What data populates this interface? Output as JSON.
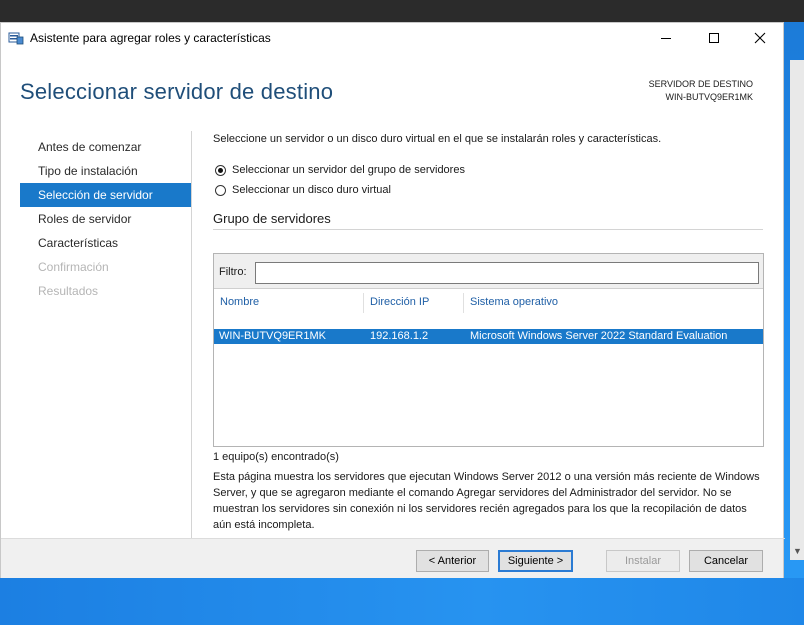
{
  "window": {
    "title": "Asistente para agregar roles y características"
  },
  "header": {
    "page_title": "Seleccionar servidor de destino",
    "dest_label": "SERVIDOR DE DESTINO",
    "dest_value": "WIN-BUTVQ9ER1MK"
  },
  "nav": {
    "items": [
      {
        "label": "Antes de comenzar",
        "state": "normal"
      },
      {
        "label": "Tipo de instalación",
        "state": "normal"
      },
      {
        "label": "Selección de servidor",
        "state": "active"
      },
      {
        "label": "Roles de servidor",
        "state": "normal"
      },
      {
        "label": "Características",
        "state": "normal"
      },
      {
        "label": "Confirmación",
        "state": "disabled"
      },
      {
        "label": "Resultados",
        "state": "disabled"
      }
    ]
  },
  "main": {
    "intro": "Seleccione un servidor o un disco duro virtual en el que se instalarán roles y características.",
    "radio_server_pool": "Seleccionar un servidor del grupo de servidores",
    "radio_vhd": "Seleccionar un disco duro virtual",
    "selected_option": "server_pool",
    "group_title": "Grupo de servidores",
    "filter_label": "Filtro:",
    "filter_value": "",
    "columns": [
      "Nombre",
      "Dirección IP",
      "Sistema operativo"
    ],
    "rows": [
      {
        "name": "WIN-BUTVQ9ER1MK",
        "ip": "192.168.1.2",
        "os": "Microsoft Windows Server 2022 Standard Evaluation"
      }
    ],
    "count": "1 equipo(s) encontrado(s)",
    "description": "Esta página muestra los servidores que ejecutan Windows Server 2012 o una versión más reciente de Windows Server, y que se agregaron mediante el comando Agregar servidores del Administrador del servidor. No se muestran los servidores sin conexión ni los servidores recién agregados para los que la recopilación de datos aún está incompleta."
  },
  "footer": {
    "prev": "< Anterior",
    "next": "Siguiente >",
    "install": "Instalar",
    "cancel": "Cancelar"
  },
  "colors": {
    "accent": "#1979ca",
    "title": "#1f4e79",
    "link": "#1f5fa6"
  }
}
